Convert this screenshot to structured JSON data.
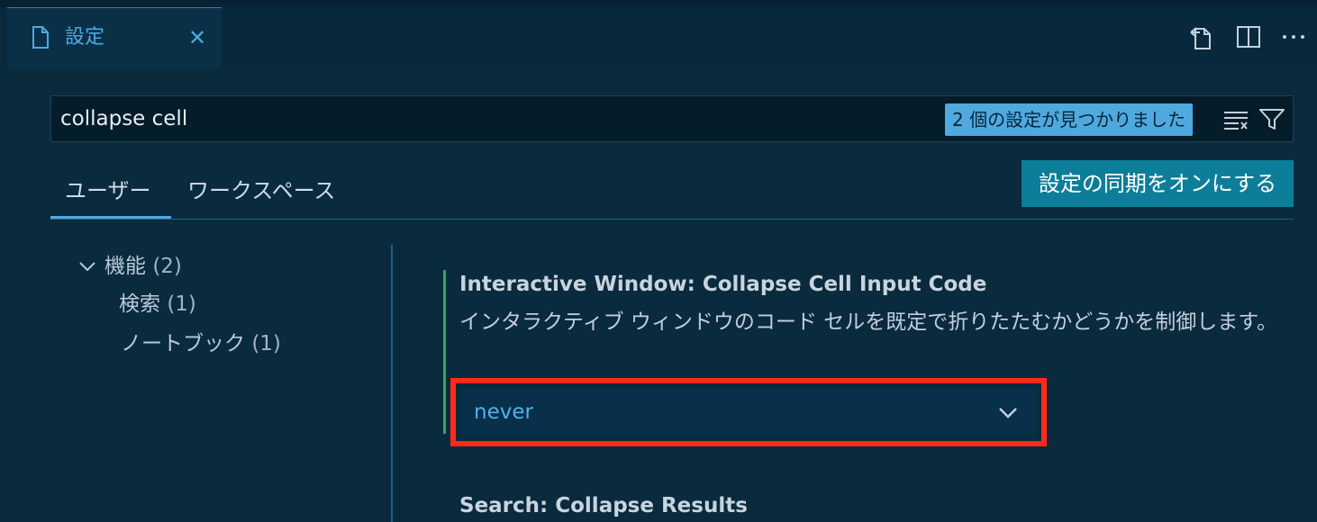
{
  "tab": {
    "label": "設定",
    "close": "✕"
  },
  "search": {
    "value": "collapse cell",
    "result_badge": "2 個の設定が見つかりました"
  },
  "scope": {
    "user_label": "ユーザー",
    "workspace_label": "ワークスペース",
    "sync_button": "設定の同期をオンにする"
  },
  "toc": {
    "features": {
      "label": "機能",
      "count": "(2)"
    },
    "search": {
      "label": "検索",
      "count": "(1)"
    },
    "notebook": {
      "label": "ノートブック",
      "count": "(1)"
    }
  },
  "settings": [
    {
      "title": "Interactive Window: Collapse Cell Input Code",
      "description": "インタラクティブ ウィンドウのコード セルを既定で折りたたむかどうかを制御します。",
      "value": "never"
    },
    {
      "title": "Search: Collapse Results"
    }
  ],
  "colors": {
    "accent": "#4fa8e0",
    "modified": "#35a851",
    "highlight": "#ff2a1a",
    "sync_button": "#0c7e99"
  }
}
